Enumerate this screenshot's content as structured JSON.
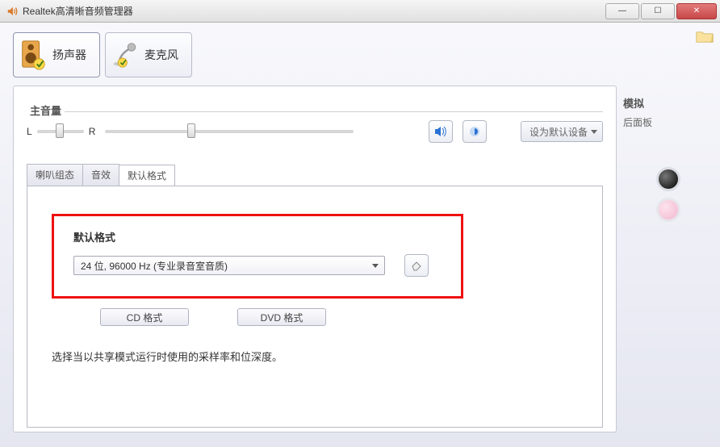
{
  "window": {
    "title": "Realtek高清晰音频管理器"
  },
  "deviceTabs": {
    "speaker": "扬声器",
    "mic": "麦克风"
  },
  "volume": {
    "title": "主音量",
    "L": "L",
    "R": "R",
    "setDefault": "设为默认设备"
  },
  "subTabs": {
    "config": "喇叭组态",
    "sfx": "音效",
    "fmt": "默认格式"
  },
  "fmt": {
    "label": "默认格式",
    "selected": "24 位, 96000 Hz (专业录音室音质)",
    "cd": "CD 格式",
    "dvd": "DVD 格式",
    "desc": "选择当以共享模式运行时使用的采样率和位深度。"
  },
  "side": {
    "title": "模拟",
    "sub": "后面板"
  }
}
